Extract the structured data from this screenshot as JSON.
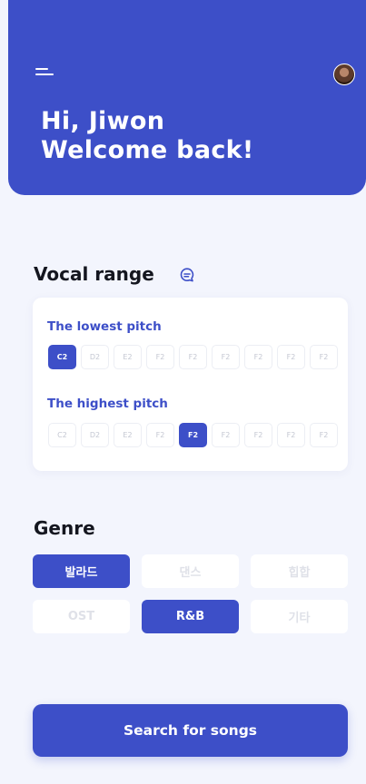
{
  "header": {
    "greeting_line1": "Hi, Jiwon",
    "greeting_line2": "Welcome back!",
    "accent_color": "#3d4fc8",
    "icons": {
      "menu": "menu-icon",
      "avatar": "avatar"
    }
  },
  "vocal_range": {
    "title": "Vocal range",
    "icon": "chat-icon",
    "lowest": {
      "label": "The lowest pitch",
      "chips": [
        "C2",
        "D2",
        "E2",
        "F2",
        "F2",
        "F2",
        "F2",
        "F2",
        "F2"
      ],
      "selected": "C2"
    },
    "highest": {
      "label": "The highest pitch",
      "chips": [
        "C2",
        "D2",
        "E2",
        "F2",
        "F2",
        "F2",
        "F2",
        "F2",
        "F2"
      ],
      "selected": "F2"
    }
  },
  "genre": {
    "title": "Genre",
    "options": [
      "발라드",
      "댄스",
      "힙합",
      "OST",
      "R&B",
      "기타"
    ],
    "selected": [
      "발라드",
      "R&B"
    ]
  },
  "search_button_label": "Search for songs"
}
